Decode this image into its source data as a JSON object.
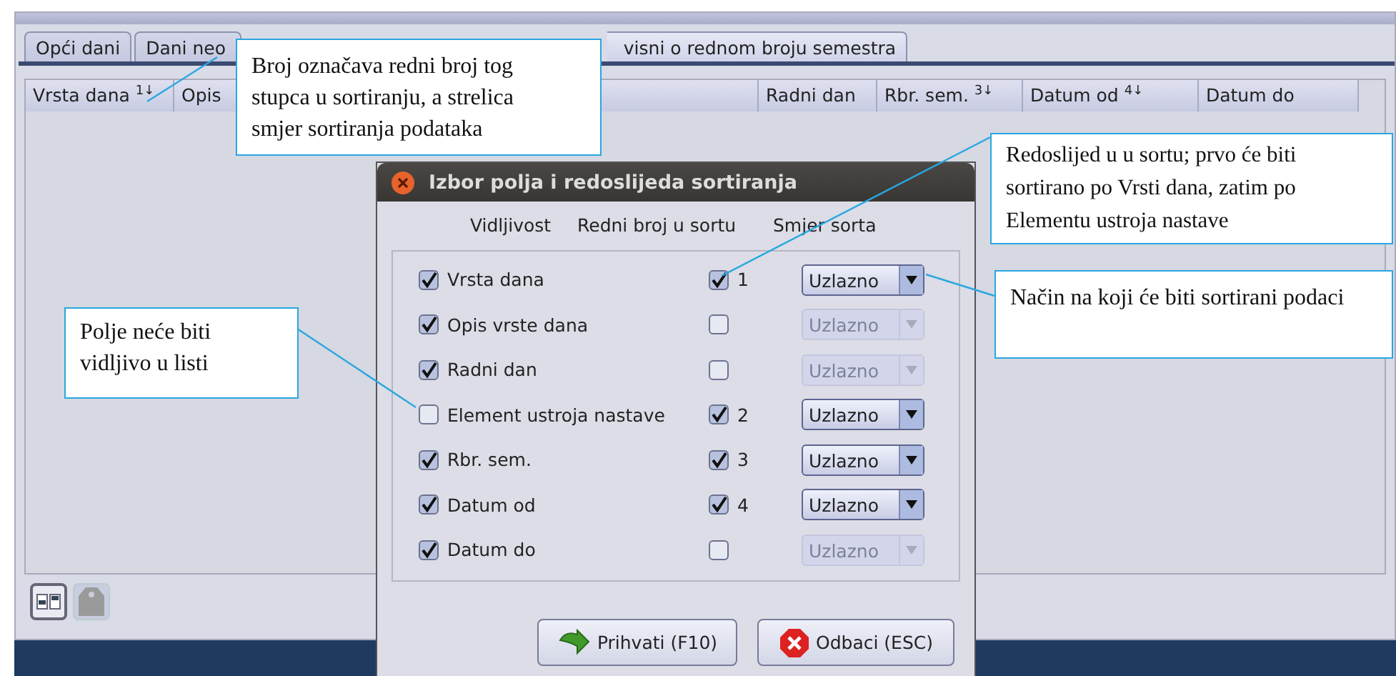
{
  "tabs": [
    {
      "label": "Opći dani",
      "selected": false
    },
    {
      "label": "Dani neo",
      "selected": false
    },
    {
      "label": "visni o rednom broju semestra",
      "selected": true
    }
  ],
  "table": {
    "columns": [
      {
        "label": "Vrsta dana",
        "sort_mark": "1↓"
      },
      {
        "label": "Opis"
      },
      {
        "kind": "blank"
      },
      {
        "label": "Radni dan"
      },
      {
        "label": "Rbr. sem.",
        "sort_mark": "3↓"
      },
      {
        "label": "Datum od",
        "sort_mark": "4↓"
      },
      {
        "label": "Datum do"
      }
    ]
  },
  "toolbar": [
    {
      "kind": "layout",
      "disabled": false
    },
    {
      "kind": "tag",
      "disabled": true
    }
  ],
  "dialog": {
    "title": "Izbor polja i redoslijeda sortiranja",
    "headers": [
      "Vidljivost",
      "Redni broj u sortu",
      "Smjer sorta"
    ],
    "rows": [
      {
        "label": "Vrsta dana",
        "visible": true,
        "sorted": true,
        "order": "1",
        "direction": "Uzlazno"
      },
      {
        "label": "Opis vrste dana",
        "visible": true,
        "sorted": false,
        "direction": "Uzlazno"
      },
      {
        "label": "Radni dan",
        "visible": true,
        "sorted": false,
        "direction": "Uzlazno"
      },
      {
        "label": "Element ustroja nastave",
        "visible": false,
        "sorted": true,
        "order": "2",
        "direction": "Uzlazno"
      },
      {
        "label": "Rbr. sem.",
        "visible": true,
        "sorted": true,
        "order": "3",
        "direction": "Uzlazno"
      },
      {
        "label": "Datum od",
        "visible": true,
        "sorted": true,
        "order": "4",
        "direction": "Uzlazno"
      },
      {
        "label": "Datum do",
        "visible": true,
        "sorted": false,
        "direction": "Uzlazno"
      }
    ],
    "buttons": [
      {
        "kind": "accept",
        "label": "Prihvati (F10)"
      },
      {
        "kind": "cancel",
        "label": "Odbaci (ESC)"
      }
    ]
  },
  "annotations": [
    {
      "text": "Broj označava redni broj tog stupca u sortiranju, a strelica smjer sortiranja podataka"
    },
    {
      "text": "Redoslijed u u sortu; prvo će biti sortirano po Vrsti  dana, zatim po Elementu ustroja nastave"
    },
    {
      "text": "Način na koji će biti sortirani podaci"
    },
    {
      "text": "Polje neće biti vidljivo u listi"
    }
  ]
}
